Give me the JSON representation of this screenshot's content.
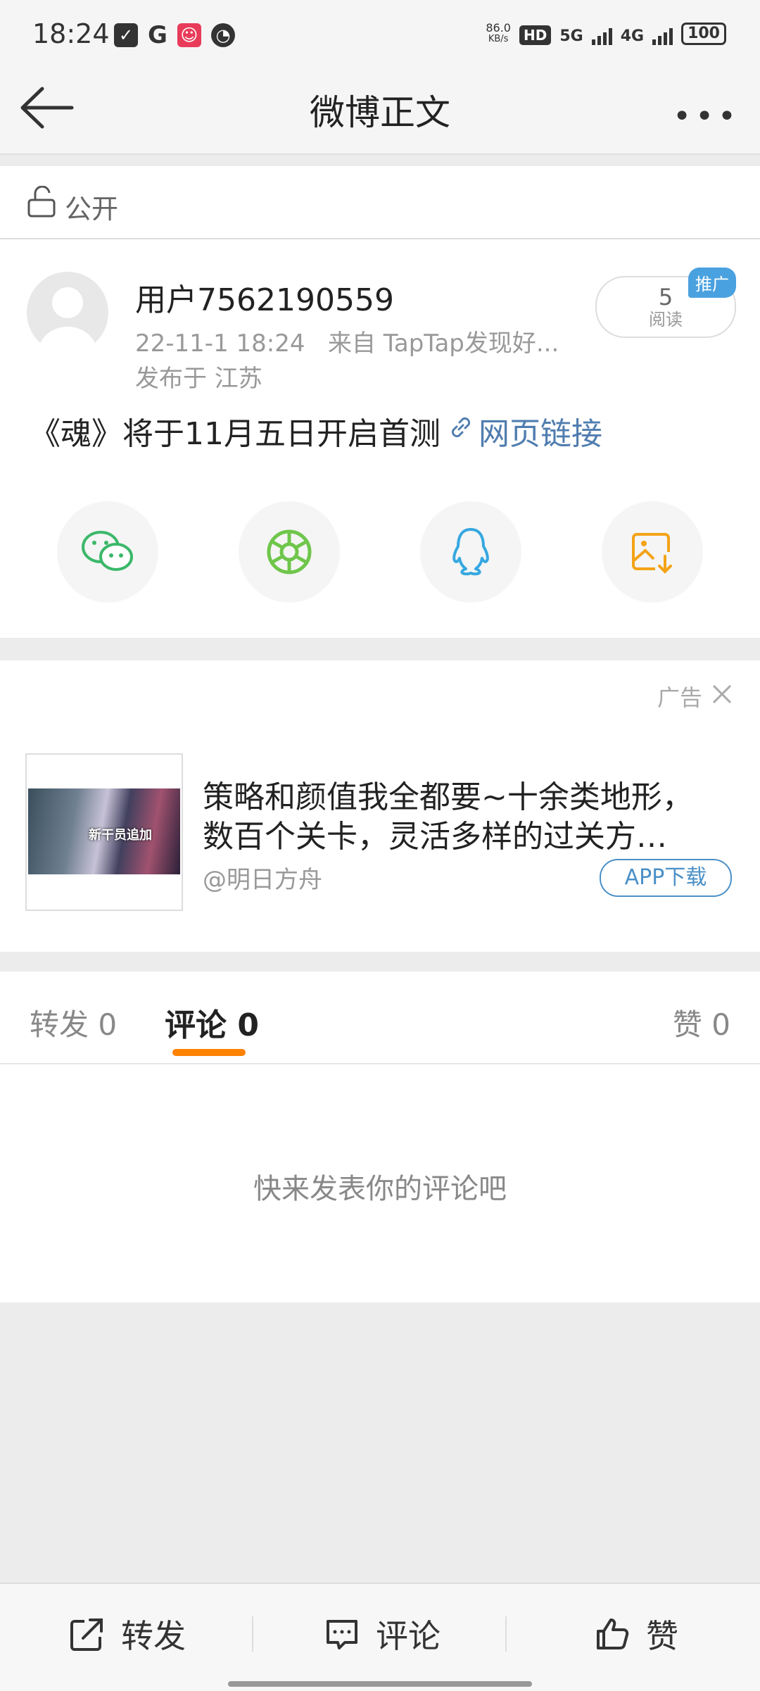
{
  "status_bar": {
    "time": "18:24",
    "speed_value": "86.0",
    "speed_unit": "KB/s",
    "hd": "HD",
    "net1": "5G",
    "net2": "4G",
    "battery": "100"
  },
  "header": {
    "title": "微博正文"
  },
  "visibility": {
    "label": "公开"
  },
  "post": {
    "username": "用户7562190559",
    "time": "22-11-1 18:24",
    "source": "来自 TapTap发现好...",
    "location": "发布于 江苏",
    "reads": "5",
    "reads_label": "阅读",
    "promo_tag": "推广",
    "text": "《魂》将于11月五日开启首测",
    "link_text": "网页链接"
  },
  "share": {
    "items": [
      "wechat-icon",
      "moments-icon",
      "qq-icon",
      "save-image-icon"
    ]
  },
  "ad": {
    "label": "广告",
    "title_line1": "策略和颜值我全都要~十余类地形，",
    "title_line2": "数百个关卡，灵活多样的过关方…",
    "author": "@明日方舟",
    "button": "APP下载",
    "image_text": "新干员追加"
  },
  "tabs": {
    "repost": "转发 0",
    "comment": "评论 0",
    "like": "赞 0"
  },
  "comments": {
    "empty_text": "快来发表你的评论吧"
  },
  "bottom_bar": {
    "repost": "转发",
    "comment": "评论",
    "like": "赞"
  },
  "colors": {
    "accent": "#ff8200",
    "link": "#507daf",
    "wechat": "#3bb86a",
    "moments": "#6fc64b",
    "qq": "#36a8e0",
    "save": "#f3a317"
  }
}
